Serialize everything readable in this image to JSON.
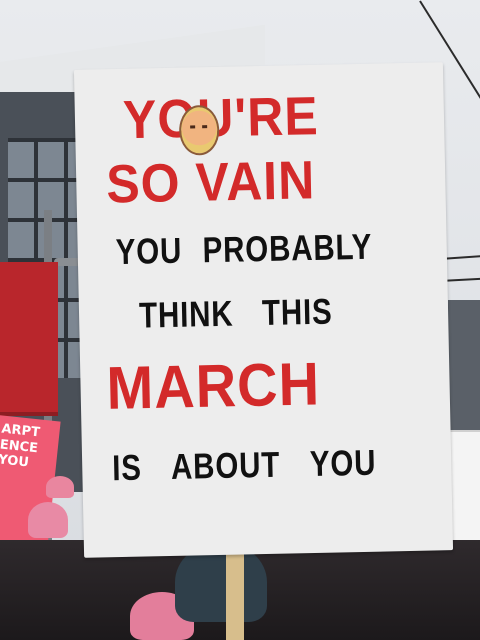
{
  "sign": {
    "line1": "YOU'RE",
    "line2": "SO VAIN",
    "line3": "YOU PROBABLY",
    "line4": "THINK THIS",
    "line5": "MARCH",
    "line6": "IS ABOUT YOU"
  },
  "background_sign": {
    "text": "ARPT ENCE YOU"
  },
  "colors": {
    "sign_red": "#d32a2a",
    "sign_black": "#111111",
    "sign_white": "#ededed",
    "pink_sign": "#ef5a73",
    "red_banner": "#b9262c"
  }
}
